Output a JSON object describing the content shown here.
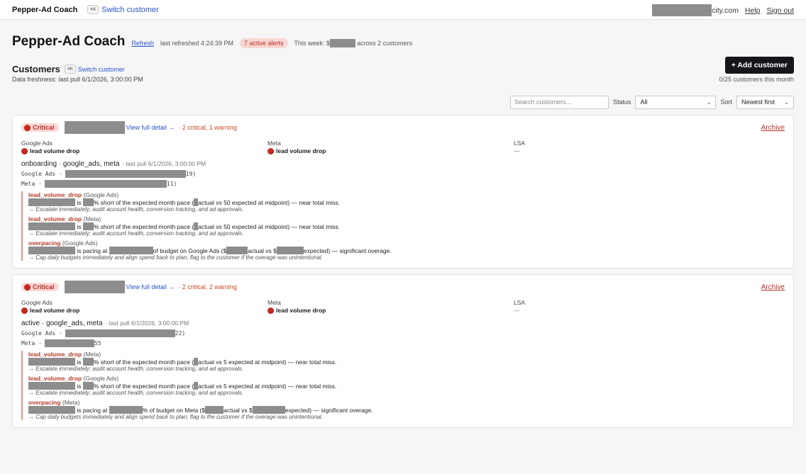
{
  "topbar": {
    "brand": "Pepper-Ad Coach",
    "kbd": "⌘K",
    "switch_label": "Switch customer",
    "email_suffix": "city.com",
    "help": "Help",
    "signout": "Sign out"
  },
  "header": {
    "title": "Pepper-Ad Coach",
    "refresh": "Refresh",
    "last_refreshed": "last refreshed 4:24:39 PM",
    "alerts_pill": "7 active alerts",
    "this_week_prefix": "This week: $",
    "this_week_suffix": "across 2 customers"
  },
  "customers": {
    "title": "Customers",
    "kbd": "⌘K",
    "switch_label": "Switch customer",
    "freshness": "Data freshness: last pull 6/1/2026, 3:00:00 PM",
    "add_button": "+ Add customer",
    "quota": "0/25 customers this month"
  },
  "filters": {
    "search_placeholder": "Search customers...",
    "status_label": "Status",
    "status_value": "All",
    "sort_label": "Sort",
    "sort_value": "Newest first"
  },
  "cards": [
    {
      "badge": "Critical",
      "view_detail": "View full detail →",
      "counts": "· 2 critical, 1 warning",
      "archive": "Archive",
      "platforms": [
        {
          "name": "Google Ads",
          "status": "lead volume drop"
        },
        {
          "name": "Meta",
          "status": "lead volume drop"
        },
        {
          "name": "LSA",
          "status": "—"
        }
      ],
      "stage": "onboarding · google_ads, meta",
      "pull": "· last pull 6/1/2026, 3:00:00 PM",
      "acct_google_label": "Google Ads ·",
      "acct_google_tail": "19)",
      "acct_meta_label": "Meta ·",
      "acct_meta_tail": "11)",
      "alerts": [
        {
          "code": "lead_volume_drop",
          "platform": "(Google Ads)",
          "pre": "is",
          "mid": "% short of the expected month pace (",
          "post": " actual vs 50 expected at midpoint) — near total miss.",
          "rec": "→ Escalate immediately; audit account health, conversion tracking, and ad approvals."
        },
        {
          "code": "lead_volume_drop",
          "platform": "(Meta)",
          "pre": "is",
          "mid": "% short of the expected month pace (",
          "post": " actual vs 50 expected at midpoint) — near total miss.",
          "rec": "→ Escalate immediately; audit account health, conversion tracking, and ad approvals."
        },
        {
          "code": "overpacing",
          "platform": "(Google Ads)",
          "pre": "is pacing at",
          "mid": "of budget on Google Ads ($",
          "mid2": "actual vs $",
          "post": "expected) — significant overage.",
          "rec": "→ Cap daily budgets immediately and align spend back to plan; flag to the customer if the overage was unintentional."
        }
      ]
    },
    {
      "badge": "Critical",
      "view_detail": "View full detail →",
      "counts": "· 2 critical, 2 warning",
      "archive": "Archive",
      "platforms": [
        {
          "name": "Google Ads",
          "status": "lead volume drop"
        },
        {
          "name": "Meta",
          "status": "lead volume drop"
        },
        {
          "name": "LSA",
          "status": "—"
        }
      ],
      "stage": "active · google_ads, meta",
      "pull": "· last pull 6/1/2026, 3:00:00 PM",
      "acct_google_label": "Google Ads ·",
      "acct_google_tail": "22)",
      "acct_meta_label": "Meta ·",
      "acct_meta_tail": "55",
      "alerts": [
        {
          "code": "lead_volume_drop",
          "platform": "(Meta)",
          "pre": "is",
          "mid": "% short of the expected month pace (",
          "post": " actual vs 5 expected at midpoint) — near total miss.",
          "rec": "→ Escalate immediately; audit account health, conversion tracking, and ad approvals."
        },
        {
          "code": "lead_volume_drop",
          "platform": "(Google Ads)",
          "pre": "is",
          "mid": "% short of the expected month pace (",
          "post": " actual vs 5 expected at midpoint) — near total miss.",
          "rec": "→ Escalate immediately; audit account health, conversion tracking, and ad approvals."
        },
        {
          "code": "overpacing",
          "platform": "(Meta)",
          "pre": "is pacing at",
          "mid": "% of budget on Meta ($",
          "mid2": " actual vs $",
          "post": "expected) — significant overage.",
          "rec": "→ Cap daily budgets immediately and align spend back to plan; flag to the customer if the overage was unintentional."
        }
      ]
    }
  ],
  "colors": {
    "critical": "#c8291e",
    "link": "#2a55c8",
    "alert_pill_bg": "#f9d7d3",
    "button_dark": "#16161a"
  }
}
